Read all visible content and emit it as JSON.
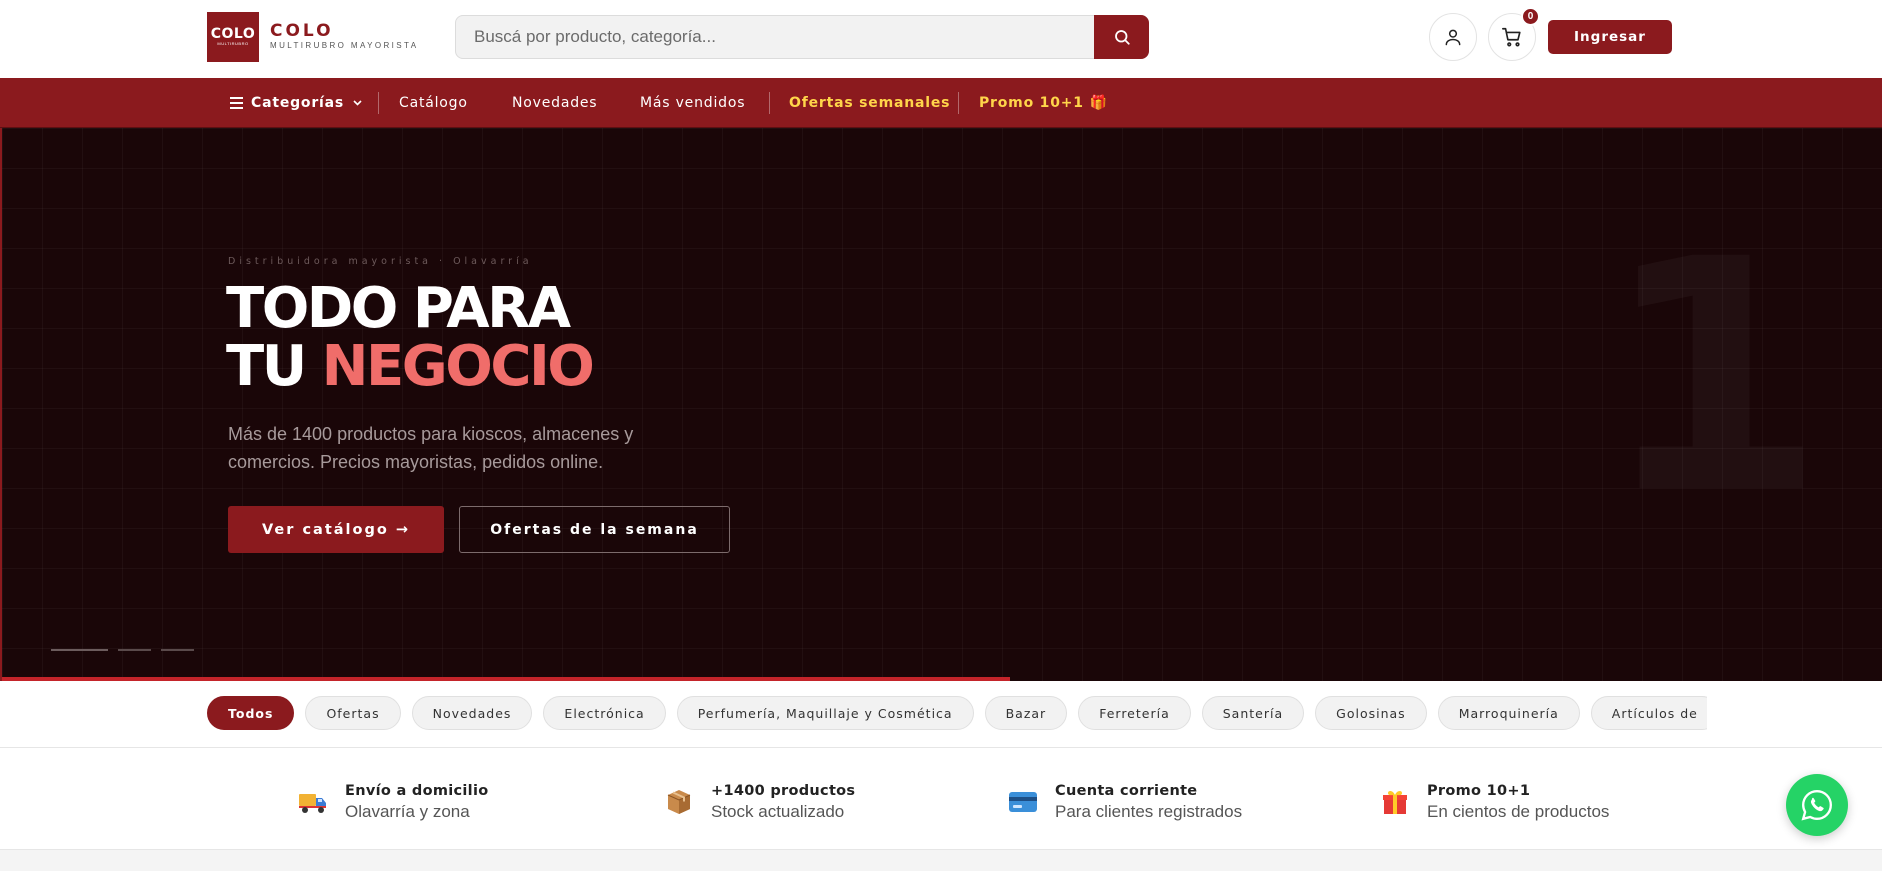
{
  "header": {
    "logo_box_main": "COLO",
    "logo_box_sub": "MULTIRUBRO",
    "logo_name": "COLO",
    "logo_tagline": "MULTIRUBRO MAYORISTA",
    "search_placeholder": "Buscá por producto, categoría...",
    "cart_count": "0",
    "login_label": "Ingresar"
  },
  "nav": {
    "categories": "Categorías",
    "items": [
      "Catálogo",
      "Novedades",
      "Más vendidos"
    ],
    "highlights": [
      "Ofertas semanales",
      "Promo 10+1 🎁"
    ]
  },
  "hero": {
    "kicker": "Distribuidora mayorista · Olavarría",
    "title_line1": "TODO PARA",
    "title_line2_a": "TU",
    "title_line2_b": "NEGOCIO",
    "description": "Más de 1400 productos para kioscos, almacenes y comercios. Precios mayoristas, pedidos online.",
    "primary_cta": "Ver catálogo →",
    "secondary_cta": "Ofertas de la semana",
    "big_number": "1",
    "slides_total": 3,
    "active_slide": 1
  },
  "filters": {
    "chips": [
      "Todos",
      "Ofertas",
      "Novedades",
      "Electrónica",
      "Perfumería, Maquillaje y Cosmética",
      "Bazar",
      "Ferretería",
      "Santería",
      "Golosinas",
      "Marroquinería",
      "Artículos de"
    ],
    "active": "Todos"
  },
  "features": [
    {
      "icon": "delivery-truck-icon",
      "title": "Envío a domicilio",
      "subtitle": "Olavarría y zona"
    },
    {
      "icon": "package-box-icon",
      "title": "+1400 productos",
      "subtitle": "Stock actualizado"
    },
    {
      "icon": "credit-card-icon",
      "title": "Cuenta corriente",
      "subtitle": "Para clientes registrados"
    },
    {
      "icon": "gift-icon",
      "title": "Promo 10+1",
      "subtitle": "En cientos de productos"
    }
  ],
  "colors": {
    "brand": "#8b1a1e",
    "accent": "#f06d6a",
    "highlight": "#ffd54a",
    "whatsapp": "#25d366"
  }
}
